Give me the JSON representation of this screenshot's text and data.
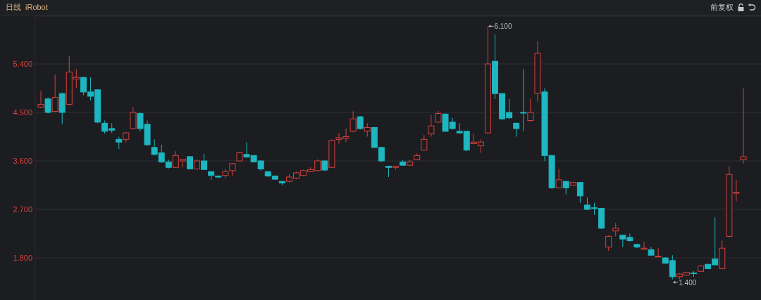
{
  "header": {
    "period": "日线",
    "symbol": "iRobot",
    "adjust": "前复权"
  },
  "chart": {
    "chart_data": {
      "type": "candlestick",
      "grid": true,
      "ylim": [
        1.018,
        6.287
      ],
      "ohlc": [
        [
          4.6,
          4.9,
          4.58,
          4.65
        ],
        [
          4.75,
          4.78,
          4.48,
          4.5
        ],
        [
          4.52,
          5.2,
          4.5,
          4.78
        ],
        [
          4.85,
          4.87,
          4.28,
          4.5
        ],
        [
          4.65,
          5.55,
          4.63,
          5.25
        ],
        [
          5.12,
          5.3,
          4.95,
          5.15
        ],
        [
          5.15,
          5.16,
          4.82,
          4.88
        ],
        [
          4.88,
          5.15,
          4.72,
          4.8
        ],
        [
          4.92,
          4.93,
          4.3,
          4.32
        ],
        [
          4.3,
          4.35,
          4.1,
          4.15
        ],
        [
          4.2,
          4.3,
          4.12,
          4.17
        ],
        [
          4.0,
          4.05,
          3.82,
          3.95
        ],
        [
          4.0,
          4.14,
          3.95,
          4.12
        ],
        [
          4.2,
          4.6,
          4.18,
          4.5
        ],
        [
          4.48,
          4.5,
          4.15,
          4.2
        ],
        [
          4.28,
          4.35,
          3.88,
          3.9
        ],
        [
          3.85,
          4.0,
          3.7,
          3.72
        ],
        [
          3.75,
          3.9,
          3.56,
          3.58
        ],
        [
          3.58,
          3.62,
          3.46,
          3.48
        ],
        [
          3.48,
          3.78,
          3.47,
          3.7
        ],
        [
          3.6,
          3.64,
          3.48,
          3.63
        ],
        [
          3.68,
          3.69,
          3.44,
          3.45
        ],
        [
          3.45,
          3.63,
          3.44,
          3.6
        ],
        [
          3.6,
          3.73,
          3.43,
          3.44
        ],
        [
          3.4,
          3.41,
          3.25,
          3.33
        ],
        [
          3.32,
          3.33,
          3.28,
          3.3
        ],
        [
          3.33,
          3.45,
          3.28,
          3.4
        ],
        [
          3.42,
          3.56,
          3.32,
          3.55
        ],
        [
          3.6,
          3.77,
          3.59,
          3.75
        ],
        [
          3.72,
          3.95,
          3.66,
          3.67
        ],
        [
          3.7,
          3.71,
          3.57,
          3.58
        ],
        [
          3.6,
          3.61,
          3.42,
          3.45
        ],
        [
          3.4,
          3.41,
          3.3,
          3.32
        ],
        [
          3.32,
          3.33,
          3.25,
          3.26
        ],
        [
          3.22,
          3.23,
          3.15,
          3.19
        ],
        [
          3.22,
          3.35,
          3.2,
          3.3
        ],
        [
          3.28,
          3.4,
          3.26,
          3.38
        ],
        [
          3.33,
          3.44,
          3.32,
          3.42
        ],
        [
          3.4,
          3.48,
          3.39,
          3.44
        ],
        [
          3.42,
          3.63,
          3.41,
          3.6
        ],
        [
          3.6,
          3.61,
          3.42,
          3.43
        ],
        [
          3.48,
          4.0,
          3.47,
          3.98
        ],
        [
          4.0,
          4.12,
          3.92,
          4.03
        ],
        [
          4.02,
          4.2,
          3.95,
          4.05
        ],
        [
          4.15,
          4.52,
          4.13,
          4.38
        ],
        [
          4.42,
          4.43,
          4.18,
          4.2
        ],
        [
          4.15,
          4.3,
          4.05,
          4.22
        ],
        [
          4.22,
          4.23,
          3.84,
          3.85
        ],
        [
          3.85,
          3.86,
          3.58,
          3.6
        ],
        [
          3.5,
          3.51,
          3.3,
          3.48
        ],
        [
          3.48,
          3.51,
          3.44,
          3.5
        ],
        [
          3.58,
          3.62,
          3.51,
          3.52
        ],
        [
          3.52,
          3.62,
          3.51,
          3.58
        ],
        [
          3.62,
          3.74,
          3.61,
          3.7
        ],
        [
          3.8,
          4.08,
          3.79,
          4.0
        ],
        [
          4.1,
          4.45,
          4.05,
          4.25
        ],
        [
          4.32,
          4.53,
          4.3,
          4.48
        ],
        [
          4.47,
          4.48,
          4.14,
          4.15
        ],
        [
          4.32,
          4.4,
          4.18,
          4.2
        ],
        [
          4.15,
          4.3,
          4.1,
          4.12
        ],
        [
          4.15,
          4.16,
          3.78,
          3.8
        ],
        [
          3.92,
          4.1,
          3.91,
          3.95
        ],
        [
          3.88,
          4.0,
          3.75,
          3.95
        ],
        [
          4.12,
          6.1,
          4.1,
          5.4
        ],
        [
          5.45,
          5.95,
          4.75,
          4.85
        ],
        [
          4.85,
          4.86,
          4.36,
          4.38
        ],
        [
          4.5,
          4.75,
          4.38,
          4.4
        ],
        [
          4.3,
          4.31,
          4.05,
          4.2
        ],
        [
          4.5,
          5.3,
          4.15,
          4.49
        ],
        [
          4.35,
          4.75,
          4.32,
          4.5
        ],
        [
          4.85,
          5.82,
          4.7,
          5.6
        ],
        [
          4.88,
          4.95,
          3.6,
          3.7
        ],
        [
          3.7,
          3.71,
          3.08,
          3.1
        ],
        [
          3.1,
          3.45,
          3.09,
          3.25
        ],
        [
          3.22,
          3.23,
          2.98,
          3.1
        ],
        [
          3.15,
          3.21,
          3.14,
          3.2
        ],
        [
          3.2,
          3.21,
          2.82,
          2.95
        ],
        [
          2.78,
          2.92,
          2.69,
          2.7
        ],
        [
          2.73,
          2.82,
          2.6,
          2.72
        ],
        [
          2.72,
          2.73,
          2.34,
          2.35
        ],
        [
          2.0,
          2.22,
          1.93,
          2.2
        ],
        [
          2.3,
          2.45,
          2.2,
          2.35
        ],
        [
          2.22,
          2.23,
          2.0,
          2.15
        ],
        [
          2.18,
          2.25,
          2.1,
          2.12
        ],
        [
          2.05,
          2.06,
          1.98,
          2.0
        ],
        [
          1.96,
          2.1,
          1.95,
          1.98
        ],
        [
          1.95,
          2.0,
          1.84,
          1.85
        ],
        [
          1.82,
          1.98,
          1.81,
          1.83
        ],
        [
          1.8,
          1.81,
          1.69,
          1.7
        ],
        [
          1.75,
          1.85,
          1.4,
          1.45
        ],
        [
          1.45,
          1.52,
          1.4,
          1.5
        ],
        [
          1.48,
          1.54,
          1.47,
          1.53
        ],
        [
          1.52,
          1.55,
          1.45,
          1.51
        ],
        [
          1.55,
          1.66,
          1.54,
          1.65
        ],
        [
          1.68,
          1.69,
          1.59,
          1.6
        ],
        [
          1.78,
          2.55,
          1.66,
          1.67
        ],
        [
          1.6,
          2.12,
          1.59,
          1.98
        ],
        [
          2.2,
          3.5,
          2.18,
          3.35
        ],
        [
          3.0,
          3.25,
          2.85,
          3.02
        ],
        [
          3.62,
          4.95,
          3.55,
          3.68
        ]
      ],
      "yticks": [
        {
          "value": 5.4,
          "label": "5.400"
        },
        {
          "value": 4.5,
          "label": "4.500"
        },
        {
          "value": 3.6,
          "label": "3.600"
        },
        {
          "value": 2.7,
          "label": "2.700"
        },
        {
          "value": 1.8,
          "label": "1.800"
        }
      ],
      "annotations": [
        "6.100",
        "1.400"
      ]
    }
  }
}
